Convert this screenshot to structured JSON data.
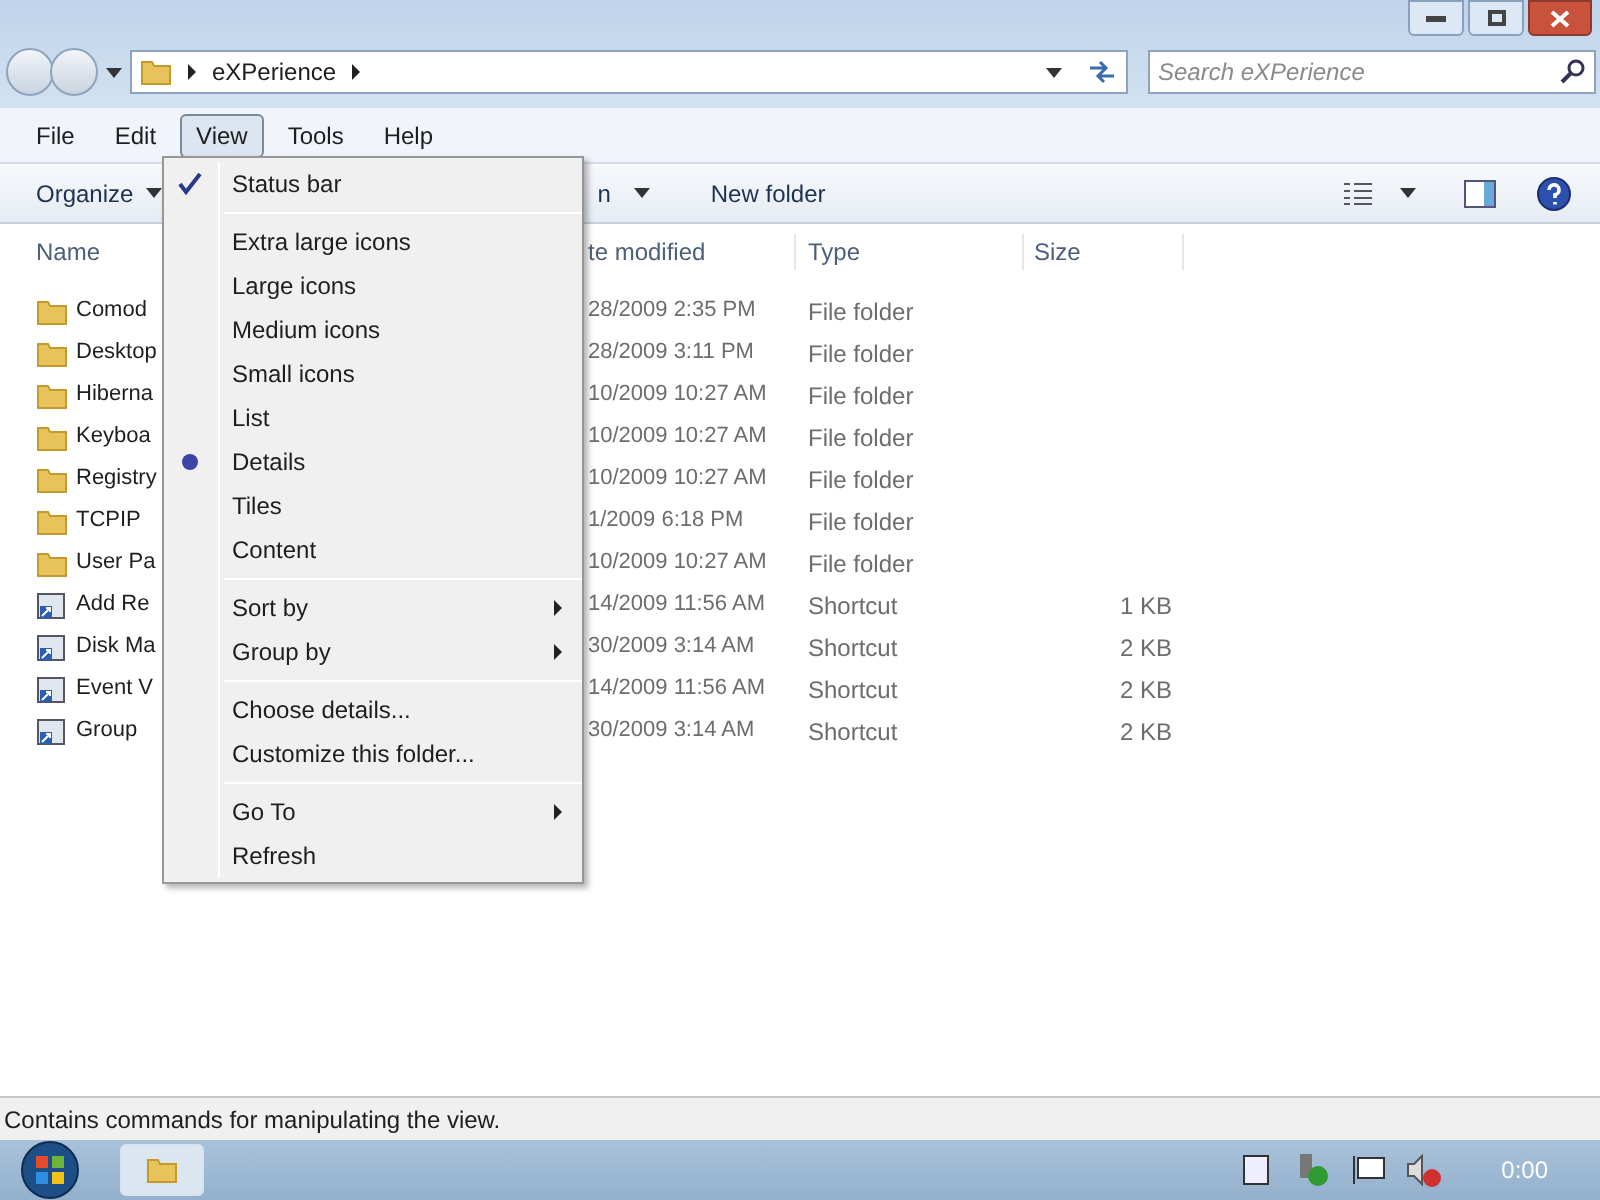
{
  "address": {
    "path": "eXPerience"
  },
  "search": {
    "placeholder": "Search eXPerience"
  },
  "menubar": [
    {
      "label": "File",
      "selected": false
    },
    {
      "label": "Edit",
      "selected": false
    },
    {
      "label": "View",
      "selected": true
    },
    {
      "label": "Tools",
      "selected": false
    },
    {
      "label": "Help",
      "selected": false
    }
  ],
  "toolbar": {
    "organize": "Organize",
    "hidden_button": "n",
    "new_folder": "New folder"
  },
  "columns": [
    "Name",
    "te modified",
    "Type",
    "Size"
  ],
  "rows": [
    {
      "kind": "folder",
      "name": "Comod",
      "date": "28/2009 2:35 PM",
      "type": "File folder"
    },
    {
      "kind": "folder",
      "name": "Desktop",
      "date": "28/2009 3:11 PM",
      "type": "File folder"
    },
    {
      "kind": "folder",
      "name": "Hiberna",
      "date": "10/2009 10:27 AM",
      "type": "File folder"
    },
    {
      "kind": "folder",
      "name": "Keyboa",
      "date": "10/2009 10:27 AM",
      "type": "File folder"
    },
    {
      "kind": "folder",
      "name": "Registry",
      "date": "10/2009 10:27 AM",
      "type": "File folder"
    },
    {
      "kind": "folder",
      "name": "TCPIP",
      "date": "1/2009 6:18 PM",
      "type": "File folder"
    },
    {
      "kind": "folder",
      "name": "User Pa",
      "date": "10/2009 10:27 AM",
      "type": "File folder"
    },
    {
      "kind": "shortcut",
      "name": "Add Re",
      "date": "14/2009 11:56 AM",
      "type": "Shortcut",
      "size": "1 KB"
    },
    {
      "kind": "shortcut",
      "name": "Disk Ma",
      "date": "30/2009 3:14 AM",
      "type": "Shortcut",
      "size": "2 KB"
    },
    {
      "kind": "shortcut",
      "name": "Event V",
      "date": "14/2009 11:56 AM",
      "type": "Shortcut",
      "size": "2 KB"
    },
    {
      "kind": "shortcut",
      "name": "Group",
      "date": "30/2009 3:14 AM",
      "type": "Shortcut",
      "size": "2 KB"
    }
  ],
  "view_menu": [
    [
      {
        "label": "Status bar",
        "kind": "check",
        "checked": true,
        "submenu": false
      }
    ],
    [
      {
        "label": "Extra large icons",
        "kind": "radio",
        "checked": false,
        "submenu": false
      },
      {
        "label": "Large icons",
        "kind": "radio",
        "checked": false,
        "submenu": false
      },
      {
        "label": "Medium icons",
        "kind": "radio",
        "checked": false,
        "submenu": false
      },
      {
        "label": "Small icons",
        "kind": "radio",
        "checked": false,
        "submenu": false
      },
      {
        "label": "List",
        "kind": "radio",
        "checked": false,
        "submenu": false
      },
      {
        "label": "Details",
        "kind": "radio",
        "checked": true,
        "submenu": false
      },
      {
        "label": "Tiles",
        "kind": "radio",
        "checked": false,
        "submenu": false
      },
      {
        "label": "Content",
        "kind": "radio",
        "checked": false,
        "submenu": false
      }
    ],
    [
      {
        "label": "Sort by",
        "kind": "command",
        "checked": false,
        "submenu": true
      },
      {
        "label": "Group by",
        "kind": "command",
        "checked": false,
        "submenu": true
      }
    ],
    [
      {
        "label": "Choose details...",
        "kind": "command",
        "checked": false,
        "submenu": false
      },
      {
        "label": "Customize this folder...",
        "kind": "command",
        "checked": false,
        "submenu": false
      }
    ],
    [
      {
        "label": "Go To",
        "kind": "command",
        "checked": false,
        "submenu": true
      },
      {
        "label": "Refresh",
        "kind": "command",
        "checked": false,
        "submenu": false
      }
    ]
  ],
  "status_bar": {
    "text": "Contains commands for manipulating the view."
  },
  "taskbar": {
    "clock": "0:00"
  }
}
